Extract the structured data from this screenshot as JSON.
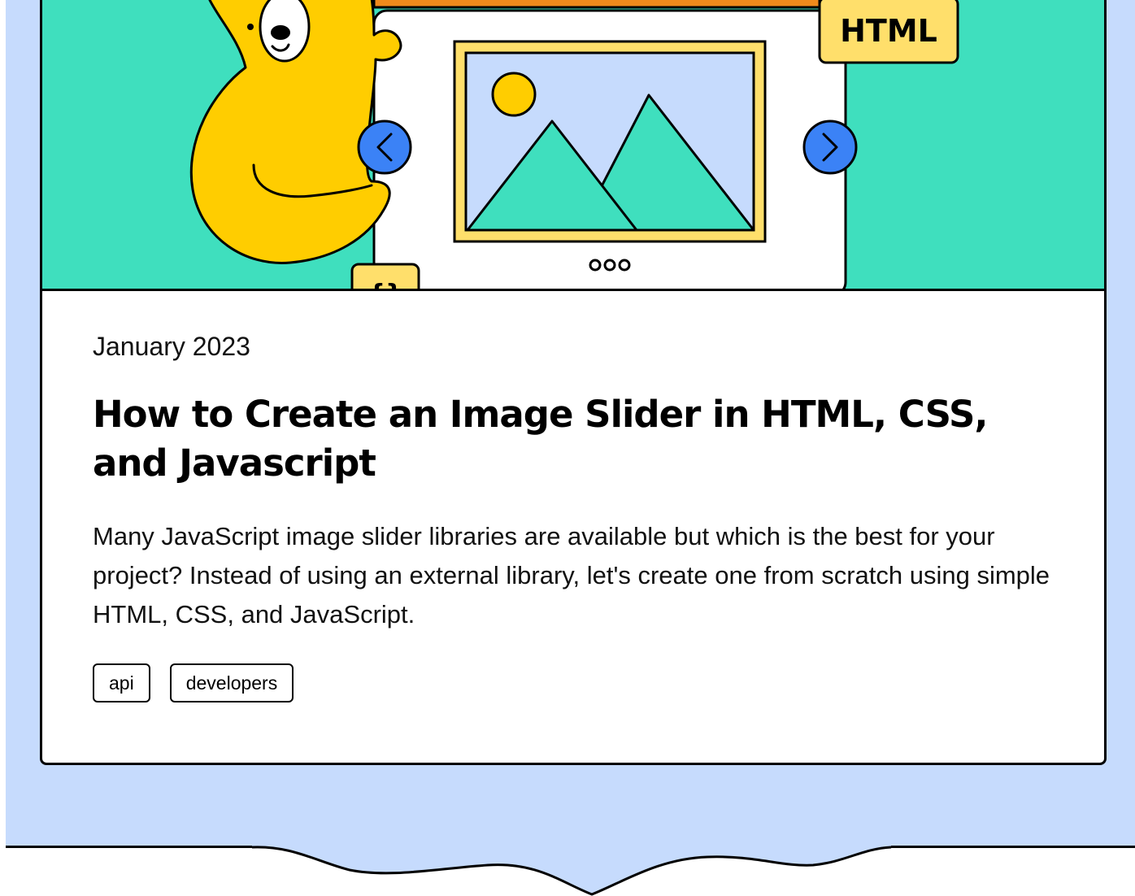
{
  "hero": {
    "badge_label": "HTML",
    "corner_badge_label": "{}",
    "colors": {
      "background": "#3fdfbe",
      "arrow": "#3b82f6",
      "bear": "#ffcd00",
      "frame": "#ffdf6b",
      "sky": "#c6dbfd",
      "mountain": "#3fdfbe",
      "orange": "#f08a1c"
    },
    "prev_icon": "chevron-left-icon",
    "next_icon": "chevron-right-icon"
  },
  "post": {
    "date": "January 2023",
    "title": "How to Create an Image Slider in HTML, CSS, and Javascript",
    "description": "Many JavaScript image slider libraries are available but which is the best for your project? Instead of using an external library, let's create one from scratch using simple HTML, CSS, and JavaScript.",
    "tags": [
      "api",
      "developers"
    ]
  },
  "page": {
    "background": "#c6dbfd"
  }
}
